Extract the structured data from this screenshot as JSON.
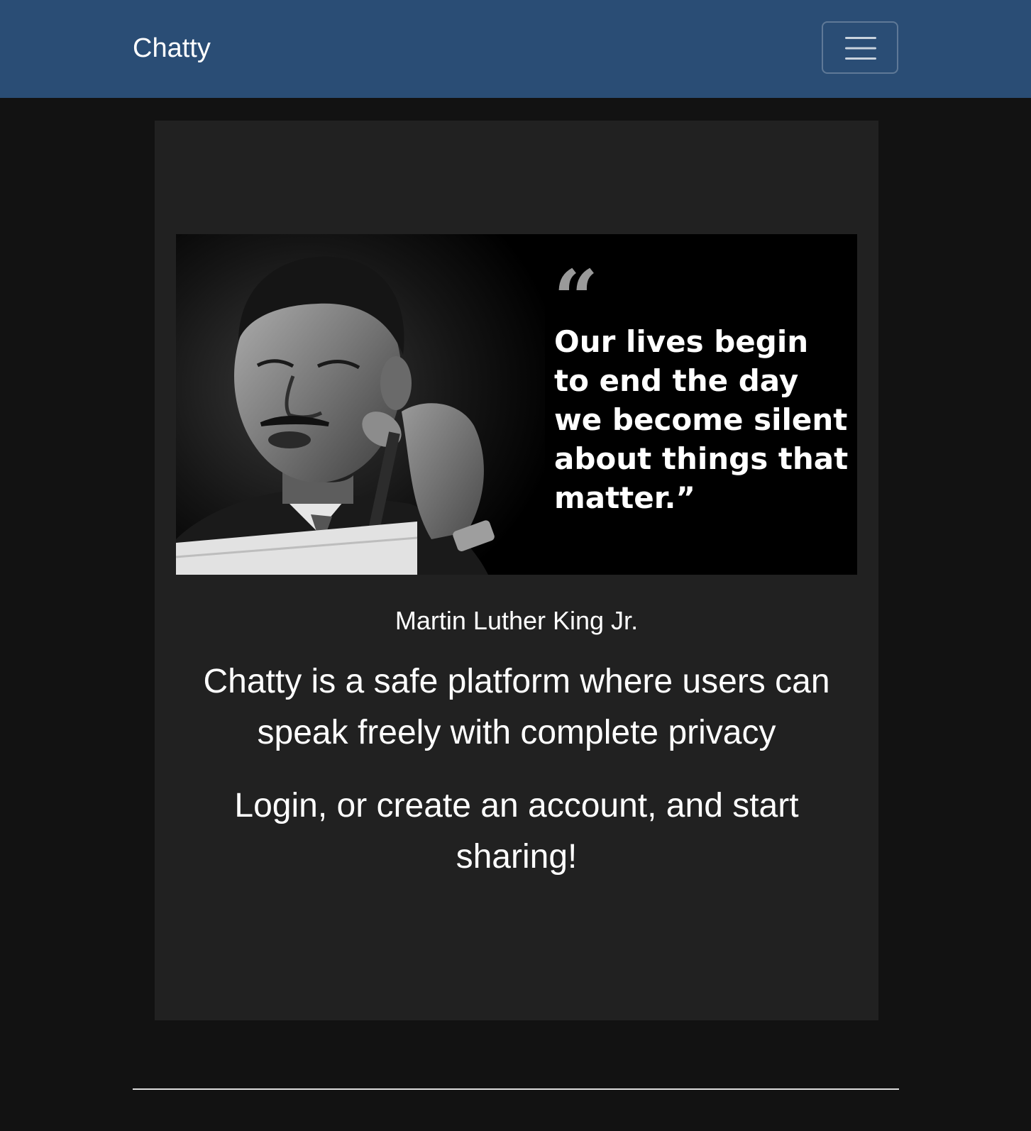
{
  "navbar": {
    "brand": "Chatty",
    "menu_icon": "hamburger-menu-icon",
    "background_color": "#2a4d75"
  },
  "hero": {
    "quote_text": "Our lives begin\nto end the day\nwe become silent\nabout things that\nmatter.”",
    "quote_mark": "“",
    "author": "Martin Luther King Jr."
  },
  "content": {
    "tagline": "Chatty is a safe platform where users can speak freely with complete privacy",
    "cta": "Login, or create an account, and start sharing!"
  },
  "colors": {
    "page_background": "#121212",
    "card_background": "#212121",
    "text": "#ffffff"
  }
}
